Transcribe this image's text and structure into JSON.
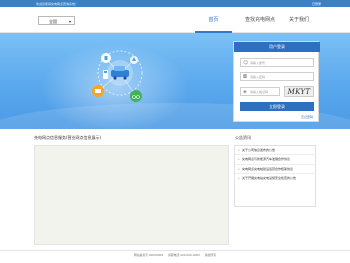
{
  "topbar": {
    "welcome": "欢迎您使用充电网点查询系统！",
    "login_link": "已登录"
  },
  "header": {
    "city_select": {
      "value": "全国"
    },
    "nav": [
      {
        "label": "首页",
        "active": true
      },
      {
        "label": "查找充电网点",
        "active": false
      },
      {
        "label": "关于我们",
        "active": false
      }
    ]
  },
  "login": {
    "title": "用户登录",
    "username_placeholder": "请输入账号",
    "password_placeholder": "请输入密码",
    "captcha_placeholder": "请输入验证码",
    "captcha_text": "MKYT",
    "submit_label": "立即登录",
    "forgot_label": "忘记密码"
  },
  "notice": {
    "title": "充电网点信息服务(营业网点信息展示)"
  },
  "news": {
    "title": "公告资讯",
    "items": [
      "关于公司信息发布的公告",
      "充电网点与新能源汽车发展合作协议",
      "充电网点充电桩建设运营合作框架协议",
      "关于开展充电站充电设施安全检查的公告"
    ]
  },
  "footer": {
    "items": [
      "网站备案号:00000000",
      "客服电话:400-000-0000",
      "版权所有"
    ]
  },
  "colors": {
    "primary": "#2d6fc0",
    "topbar": "#3b82c4",
    "banner": "#5aa8ed",
    "nav_active": "#2e7ad1"
  }
}
